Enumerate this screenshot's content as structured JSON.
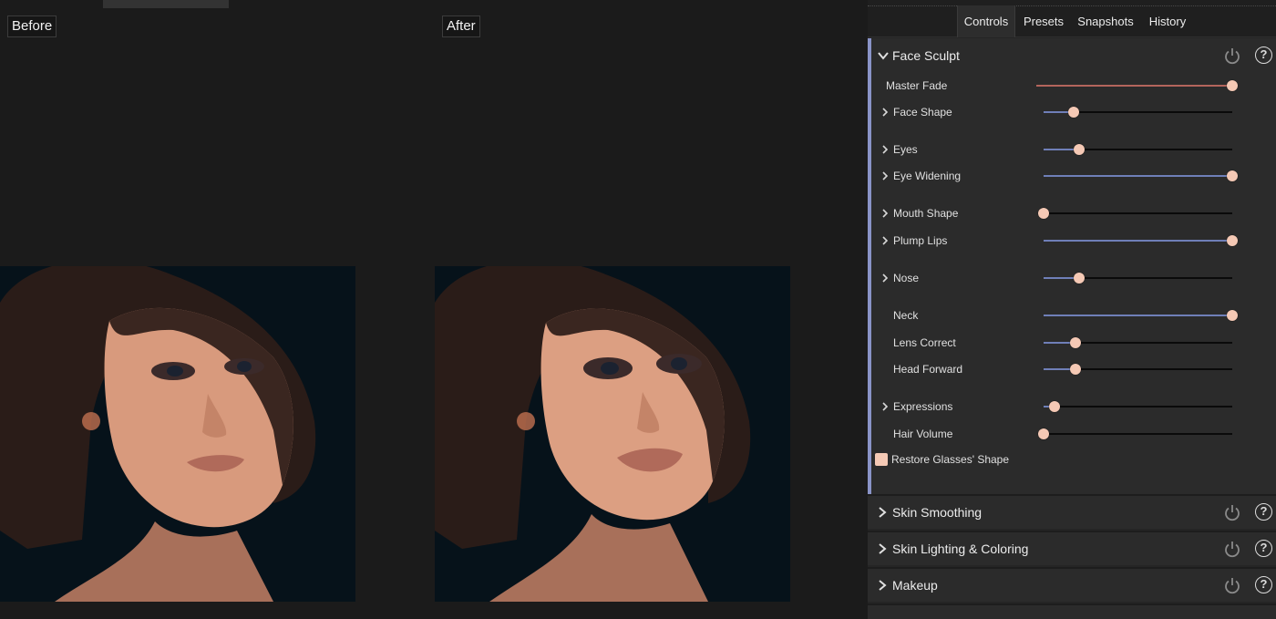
{
  "viewer": {
    "before_label": "Before",
    "after_label": "After"
  },
  "tabs": [
    {
      "label": "Controls",
      "active": true
    },
    {
      "label": "Presets",
      "active": false
    },
    {
      "label": "Snapshots",
      "active": false
    },
    {
      "label": "History",
      "active": false
    }
  ],
  "face_sculpt": {
    "title": "Face Sculpt",
    "controls": [
      {
        "label": "Master Fade",
        "value": 1.0,
        "expandable": false
      },
      {
        "label": "Face Shape",
        "value": 0.16,
        "expandable": true
      },
      {
        "label": "Eyes",
        "value": 0.19,
        "expandable": true
      },
      {
        "label": "Eye Widening",
        "value": 1.0,
        "expandable": true
      },
      {
        "label": "Mouth Shape",
        "value": 0.0,
        "expandable": true
      },
      {
        "label": "Plump Lips",
        "value": 1.0,
        "expandable": true
      },
      {
        "label": "Nose",
        "value": 0.19,
        "expandable": true
      },
      {
        "label": "Neck",
        "value": 1.0,
        "expandable": false
      },
      {
        "label": "Lens Correct",
        "value": 0.17,
        "expandable": false
      },
      {
        "label": "Head Forward",
        "value": 0.17,
        "expandable": false
      },
      {
        "label": "Expressions",
        "value": 0.06,
        "expandable": true
      },
      {
        "label": "Hair Volume",
        "value": 0.0,
        "expandable": false
      }
    ],
    "checkbox_label": "Restore Glasses' Shape",
    "checkbox_checked": true
  },
  "collapsed_sections": [
    {
      "title": "Skin Smoothing"
    },
    {
      "title": "Skin Lighting & Coloring"
    },
    {
      "title": "Makeup"
    }
  ],
  "help_glyph": "?",
  "colors": {
    "accent": "#8a94c8",
    "knob": "#f5c9b5",
    "fill_blue": "#6f7fb8",
    "fill_red": "#b4655c"
  }
}
